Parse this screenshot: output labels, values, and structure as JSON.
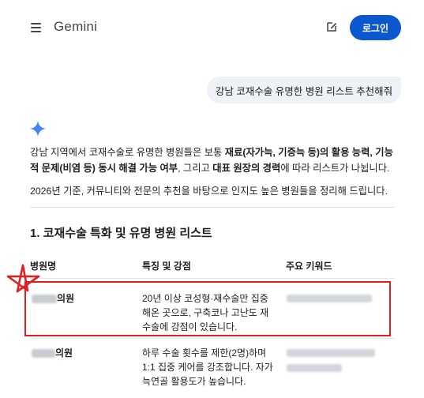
{
  "header": {
    "brand": "Gemini",
    "login_label": "로그인"
  },
  "user_prompt": "강남 코재수술 유명한 병원 리스트 추천해줘",
  "response": {
    "intro_p1_parts": [
      "강남 지역에서 코재수술로 유명한 병원들은 보통 ",
      "재료(자가늑, 기증늑 등)의 활용 능력, 기능적 문제(비염 등) 동시 해결 가능 여부",
      ", 그리고 ",
      "대표 원장의 경력",
      "에 따라 리스트가 나뉩니다."
    ],
    "intro_p2": "2026년 기준, 커뮤니티와 전문의 추천을 바탕으로 인지도 높은 병원들을 정리해 드립니다.",
    "section_title": "1. 코재수술 특화 및 유명 병원 리스트",
    "table": {
      "headers": [
        "병원명",
        "특징 및 강점",
        "주요 키워드"
      ],
      "rows": [
        {
          "name_suffix": "의원",
          "feature_lines": [
            "20년 이상 코성형·재수술만 집중",
            "해온 곳으로, 구축코나 고난도 재",
            "수술에 강점이 있습니다."
          ]
        },
        {
          "name_suffix": "의원",
          "feature_lines": [
            "하루 수술 횟수를 제한(2명)하며",
            "1:1 집중 케어를 강조합니다. 자가",
            "늑연골 활용도가 높습니다."
          ]
        }
      ]
    }
  },
  "colors": {
    "accent": "#0b57d0",
    "highlight": "#e02020",
    "spark": "#4285f4"
  }
}
